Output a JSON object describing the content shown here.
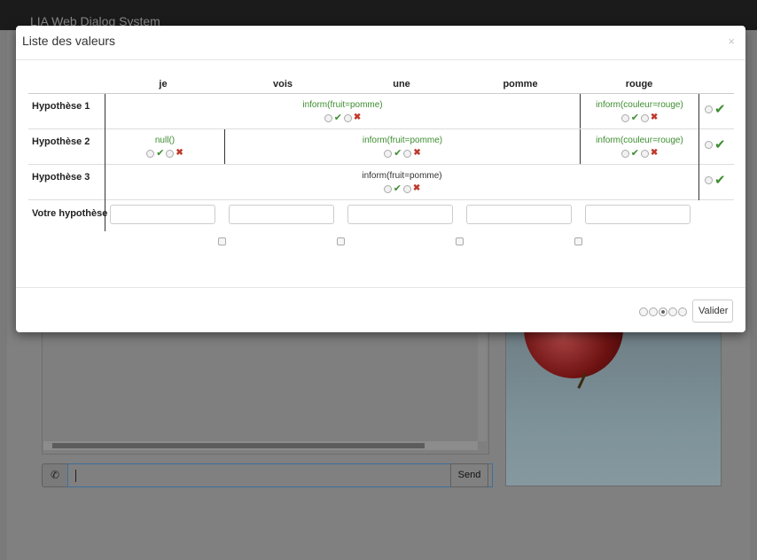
{
  "app": {
    "title": "LIA Web Dialog System"
  },
  "background": {
    "phone_icon": "phone-icon",
    "send_label": "Send"
  },
  "modal": {
    "title": "Liste des valeurs",
    "close_label": "×",
    "columns": [
      "je",
      "vois",
      "une",
      "pomme",
      "rouge"
    ],
    "rows": [
      {
        "label": "Hypothèse 1",
        "segments": [
          "inform(fruit=pomme)",
          "inform(couleur=rouge)"
        ]
      },
      {
        "label": "Hypothèse 2",
        "segments": [
          "null()",
          "inform(fruit=pomme)",
          "inform(couleur=rouge)"
        ]
      },
      {
        "label": "Hypothèse 3",
        "segments": [
          "inform(fruit=pomme)"
        ]
      }
    ],
    "user_row_label": "Votre hypothèse",
    "pagination": {
      "pages": 5,
      "current": 3
    },
    "submit_label": "Valider"
  },
  "icons": {
    "accept": "checkmark-icon",
    "reject": "cross-icon",
    "close": "close-icon"
  },
  "colors": {
    "accept": "#3c8d2f",
    "reject": "#c0392b",
    "action_text": "#3c8d2f"
  }
}
